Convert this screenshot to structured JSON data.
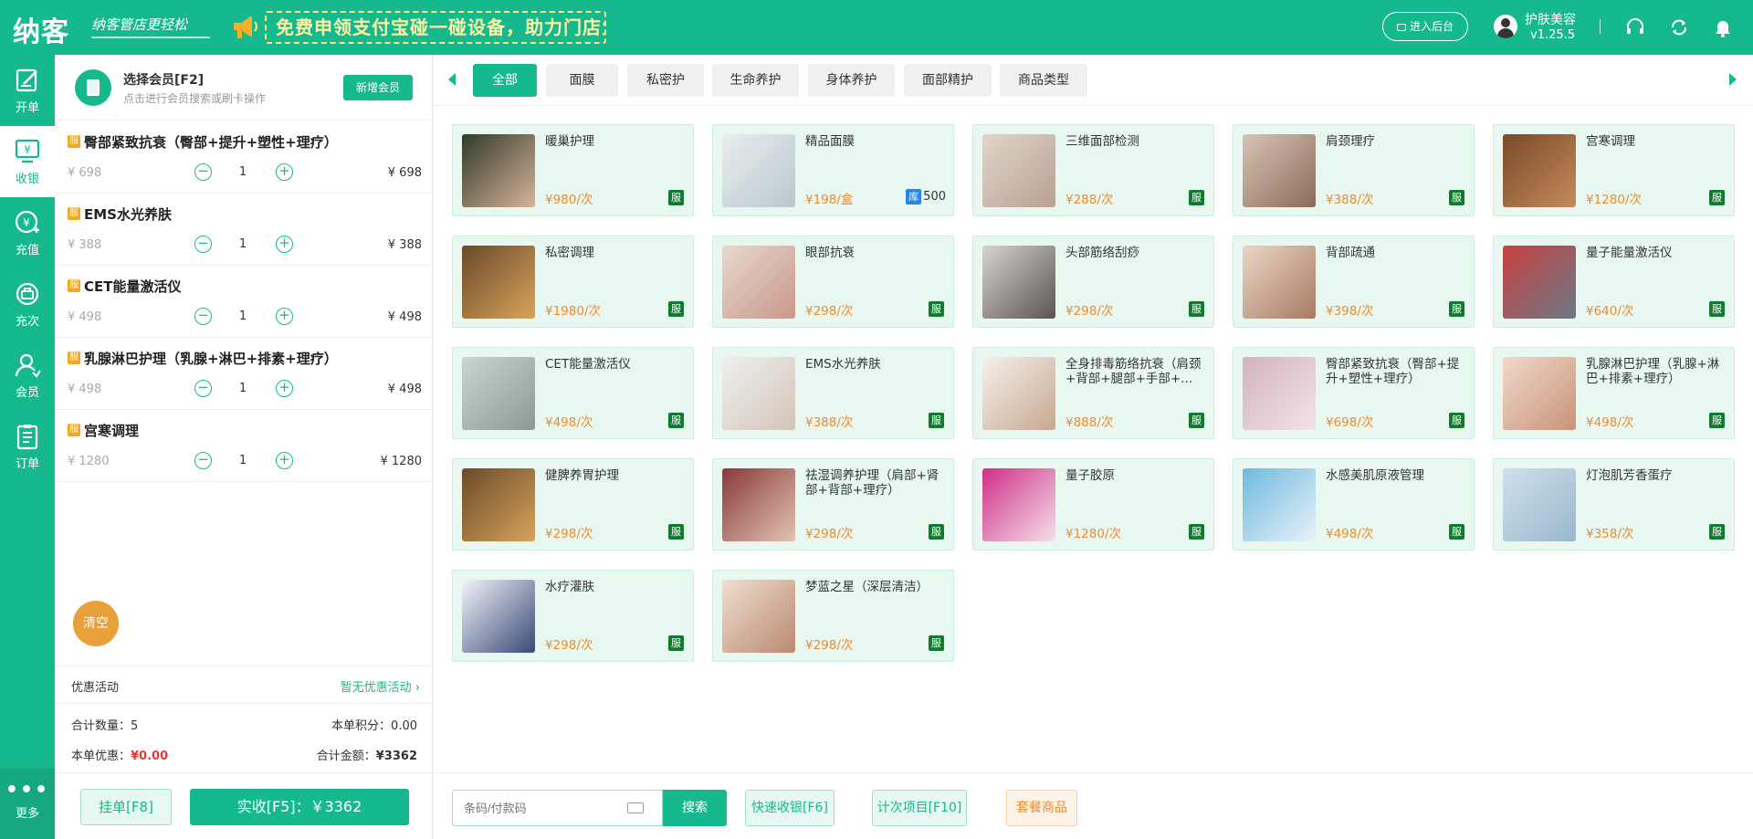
{
  "header": {
    "logo": "纳客",
    "slogan": "纳客管店更轻松",
    "promo": "免费申领支付宝碰一碰设备，助力门店业绩倍增！",
    "backend_label": "进入后台",
    "user_name": "护肤美容",
    "version": "v1.25.5"
  },
  "nav": [
    {
      "label": "开单",
      "icon": "edit-icon"
    },
    {
      "label": "收银",
      "icon": "cashier-icon"
    },
    {
      "label": "充值",
      "icon": "recharge-icon"
    },
    {
      "label": "充次",
      "icon": "times-icon"
    },
    {
      "label": "会员",
      "icon": "member-icon"
    },
    {
      "label": "订单",
      "icon": "order-icon"
    }
  ],
  "nav_more": "更多",
  "member": {
    "title": "选择会员[F2]",
    "subtitle": "点击进行会员搜索或刷卡操作",
    "new_button": "新增会员"
  },
  "cart": [
    {
      "badge": "服",
      "name": "臀部紧致抗衰（臀部+提升+塑性+理疗）",
      "orig": "¥ 698",
      "qty": "1",
      "sub": "¥ 698"
    },
    {
      "badge": "服",
      "name": "EMS水光养肤",
      "orig": "¥ 388",
      "qty": "1",
      "sub": "¥ 388"
    },
    {
      "badge": "服",
      "name": "CET能量激活仪",
      "orig": "¥ 498",
      "qty": "1",
      "sub": "¥ 498"
    },
    {
      "badge": "服",
      "name": "乳腺淋巴护理（乳腺+淋巴+排素+理疗）",
      "orig": "¥ 498",
      "qty": "1",
      "sub": "¥ 498"
    },
    {
      "badge": "服",
      "name": "宫寒调理",
      "orig": "¥ 1280",
      "qty": "1",
      "sub": "¥ 1280"
    }
  ],
  "clear_label": "清空",
  "promo_row": {
    "label": "优惠活动",
    "value": "暂无优惠活动 ›"
  },
  "summary": {
    "qty_label": "合计数量：",
    "qty": "5",
    "points_label": "本单积分：",
    "points": "0.00",
    "discount_label": "本单优惠：",
    "discount": "¥0.00",
    "total_label": "合计金额：",
    "total": "¥3362"
  },
  "footer": {
    "hang": "挂单[F8]",
    "pay": "实收[F5]：￥3362"
  },
  "categories": [
    "全部",
    "面膜",
    "私密护",
    "生命养护",
    "身体养护",
    "面部精护",
    "商品类型"
  ],
  "products": [
    {
      "name": "暖巢护理",
      "price": "¥980/次",
      "tag": "服",
      "c1": "#2f3b2a",
      "c2": "#d9b39a"
    },
    {
      "name": "精品面膜",
      "price": "¥198/盒",
      "stock_tag": "库",
      "stock": "500",
      "c1": "#e9eef0",
      "c2": "#b8c7cc"
    },
    {
      "name": "三维面部检测",
      "price": "¥288/次",
      "tag": "服",
      "c1": "#e2d5cc",
      "c2": "#b9a091"
    },
    {
      "name": "肩颈理疗",
      "price": "¥388/次",
      "tag": "服",
      "c1": "#d8c3b4",
      "c2": "#8a6b5a"
    },
    {
      "name": "宫寒调理",
      "price": "¥1280/次",
      "tag": "服",
      "c1": "#7a4a2a",
      "c2": "#c58a5a"
    },
    {
      "name": "私密调理",
      "price": "¥1980/次",
      "tag": "服",
      "c1": "#6b4a2a",
      "c2": "#d8a35a"
    },
    {
      "name": "眼部抗衰",
      "price": "¥298/次",
      "tag": "服",
      "c1": "#e8d8cf",
      "c2": "#c9988a"
    },
    {
      "name": "头部筋络刮痧",
      "price": "¥298/次",
      "tag": "服",
      "c1": "#d9d3cf",
      "c2": "#5a5552"
    },
    {
      "name": "背部疏通",
      "price": "¥398/次",
      "tag": "服",
      "c1": "#e9d5c6",
      "c2": "#a87a60"
    },
    {
      "name": "量子能量激活仪",
      "price": "¥640/次",
      "tag": "服",
      "c1": "#c94040",
      "c2": "#6b7a86"
    },
    {
      "name": "CET能量激活仪",
      "price": "¥498/次",
      "tag": "服",
      "c1": "#c9d6d2",
      "c2": "#8a9a96"
    },
    {
      "name": "EMS水光养肤",
      "price": "¥388/次",
      "tag": "服",
      "c1": "#eef0f0",
      "c2": "#d4c3b8"
    },
    {
      "name": "全身排毒筋络抗衰（肩颈+背部+腿部+手部+...",
      "price": "¥888/次",
      "tag": "服",
      "c1": "#f4f0ec",
      "c2": "#c9a890"
    },
    {
      "name": "臀部紧致抗衰（臀部+提升+塑性+理疗）",
      "price": "¥698/次",
      "tag": "服",
      "c1": "#d2b3bb",
      "c2": "#f2e3e6"
    },
    {
      "name": "乳腺淋巴护理（乳腺+淋巴+排素+理疗）",
      "price": "¥498/次",
      "tag": "服",
      "c1": "#f0d8c9",
      "c2": "#c99478"
    },
    {
      "name": "健脾养胃护理",
      "price": "¥298/次",
      "tag": "服",
      "c1": "#6b4a2a",
      "c2": "#d8a35a"
    },
    {
      "name": "祛湿调养护理（肩部+肾部+背部+理疗）",
      "price": "¥298/次",
      "tag": "服",
      "c1": "#8a3a3a",
      "c2": "#e0c4b0"
    },
    {
      "name": "量子胶原",
      "price": "¥1280/次",
      "tag": "服",
      "c1": "#d02f8a",
      "c2": "#f3e0e6"
    },
    {
      "name": "水感美肌原液管理",
      "price": "¥498/次",
      "tag": "服",
      "c1": "#6fb9e0",
      "c2": "#e8f2f8"
    },
    {
      "name": "灯泡肌芳香蛋疗",
      "price": "¥358/次",
      "tag": "服",
      "c1": "#cfe0ec",
      "c2": "#9ab8cc"
    },
    {
      "name": "水疗灌肤",
      "price": "¥298/次",
      "tag": "服",
      "c1": "#f2f4f8",
      "c2": "#3a4a7a"
    },
    {
      "name": "梦蓝之星（深层清洁）",
      "price": "¥298/次",
      "tag": "服",
      "c1": "#f0ddd0",
      "c2": "#b98a70"
    }
  ],
  "bottom": {
    "placeholder": "条码/付款码",
    "search": "搜索",
    "quick": "快速收银[F6]",
    "times": "计次项目[F10]",
    "package": "套餐商品"
  },
  "colors": {
    "brand": "#16b98d",
    "price": "#f08a2b",
    "tag": "#117a2f"
  }
}
